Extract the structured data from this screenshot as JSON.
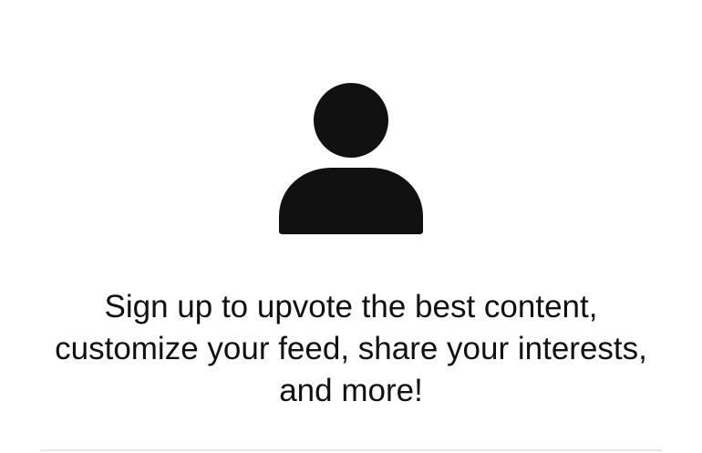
{
  "signup_prompt": {
    "icon": "user-avatar-icon",
    "message": "Sign up to upvote the best content, customize your feed, share your interests, and more!"
  },
  "colors": {
    "background": "#ffffff",
    "icon": "#111111",
    "text": "#111111",
    "divider": "#e6e6e6"
  }
}
